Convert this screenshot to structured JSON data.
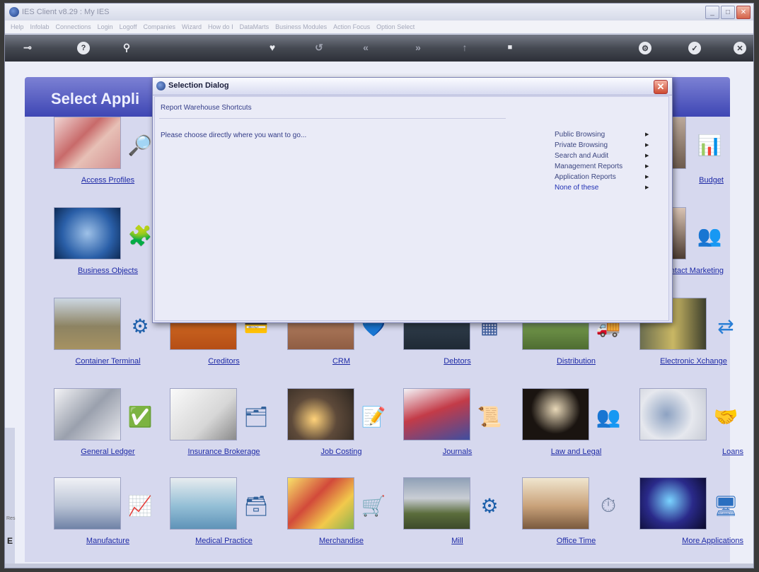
{
  "window": {
    "title": "IES Client v8.29 : My IES",
    "minimize": "_",
    "maximize": "□",
    "close": "✕"
  },
  "menu": [
    "Help",
    "Infolab",
    "Connections",
    "Login",
    "Logoff",
    "Companies",
    "Wizard",
    "How do I",
    "DataMarts",
    "Business Modules",
    "Action Focus",
    "Option Select"
  ],
  "toolbar": {
    "pin": "⊸",
    "help": "?",
    "search": "⚲",
    "heart": "♥",
    "refresh": "↺",
    "back": "«",
    "forward": "»",
    "up": "↑",
    "stop": "■",
    "settings": "⚙",
    "ok": "✓",
    "close": "✕"
  },
  "page_title": "Select Appli",
  "dialog": {
    "title": "Selection Dialog",
    "close": "✕",
    "heading": "Report Warehouse Shortcuts",
    "prompt": "Please choose directly where you want to go...",
    "menu": [
      {
        "label": "Public Browsing",
        "selected": false
      },
      {
        "label": "Private Browsing",
        "selected": false
      },
      {
        "label": "Search and Audit",
        "selected": false
      },
      {
        "label": "Management Reports",
        "selected": false
      },
      {
        "label": "Application Reports",
        "selected": false
      },
      {
        "label": "None of these",
        "selected": true
      }
    ],
    "arrow": "▶"
  },
  "tiles": {
    "row1": {
      "access_profiles": "Access Profiles",
      "budget": "Budget"
    },
    "row2": {
      "business_objects": "Business Objects",
      "contact_marketing": "Contact Marketing"
    },
    "row3": [
      "Container Terminal",
      "Creditors",
      "CRM",
      "Debtors",
      "Distribution",
      "Electronic Xchange"
    ],
    "row4": [
      "General Ledger",
      "Insurance Brokerage",
      "Job Costing",
      "Journals",
      "Law and Legal",
      "Loans"
    ],
    "row5": [
      "Manufacture",
      "Medical Practice",
      "Merchandise",
      "Mill",
      "Office Time",
      "More Applications"
    ]
  },
  "left_strip": {
    "text": "Res",
    "letter": "E"
  },
  "colors": {
    "header": "#3e46b4",
    "link": "#1e2aa6",
    "panel": "#d6d8ee"
  }
}
